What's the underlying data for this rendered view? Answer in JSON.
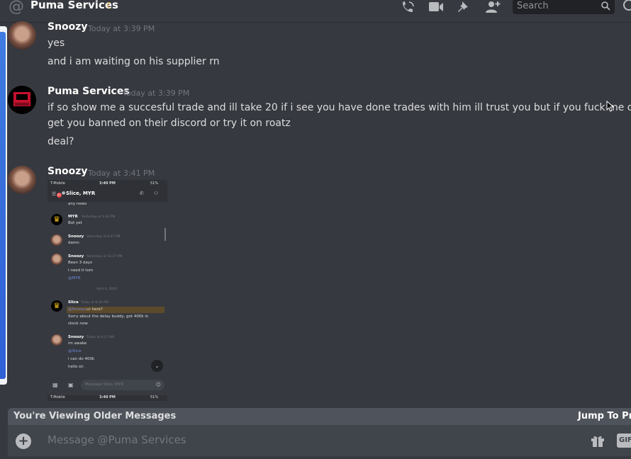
{
  "header": {
    "title": "Puma Services",
    "status_icon": "moon-icon",
    "icons": [
      "call-icon",
      "video-icon",
      "pin-icon",
      "add-member-icon"
    ],
    "search_placeholder": "Search"
  },
  "messages": [
    {
      "author": "Snoozy",
      "timestamp": "Today at 3:39 PM",
      "lines": [
        "yes",
        "and i am waiting on his supplier rn"
      ]
    },
    {
      "author": "Puma Services",
      "timestamp": "Today at 3:39 PM",
      "lines": [
        "if so show me a succesful trade and ill take 20 if i see you have done trades with him ill trust you but if you fuck me over ill",
        "get you banned on their discord or  try it on roatz",
        "deal?"
      ]
    },
    {
      "author": "Snoozy",
      "timestamp": "Today at 3:41 PM",
      "attachment": "embedded-screenshot"
    }
  ],
  "embedded": {
    "carrier": "T-Mobile",
    "time": "3:40 PM",
    "battery": "51%",
    "channel": "Slice, MYR",
    "badge": "97",
    "any_news": "any news",
    "msgs": [
      {
        "name": "MYR",
        "ts": "Yesterday at 6:30 PM",
        "lines": [
          "Bot yet"
        ]
      },
      {
        "name": "Snoozy",
        "ts": "Yesterday at 8:27 PM",
        "lines": [
          "damn"
        ]
      },
      {
        "name": "Snoozy",
        "ts": "Yesterday at 11:37 PM",
        "lines": [
          "Been 3 days",
          "I need it tom"
        ],
        "mention": "@MYR"
      },
      {
        "name": "Slice",
        "ts": "Today at 6:19 AM",
        "quote_mention": "@Snoozy",
        "quote_text": " ur here?",
        "lines": [
          "Sorry about the delay buddy, got 400k in",
          "stock now"
        ]
      },
      {
        "name": "Snoozy",
        "ts": "Today at 9:27 AM",
        "lines": [
          "im awake"
        ],
        "mention": "@Slice",
        "lines2": [
          "i can do 400k",
          "hello sir."
        ]
      }
    ],
    "date_divider": "April 9, 2020",
    "input_placeholder": "Message Slice, MYR",
    "next_carrier": "T-Mobile",
    "next_time": "3:40 PM",
    "next_battery": "51%"
  },
  "footer": {
    "older_messages": "You're Viewing Older Messages",
    "jump": "Jump To Present",
    "composer_placeholder": "Message @Puma Services",
    "gif_label": "GIF"
  }
}
